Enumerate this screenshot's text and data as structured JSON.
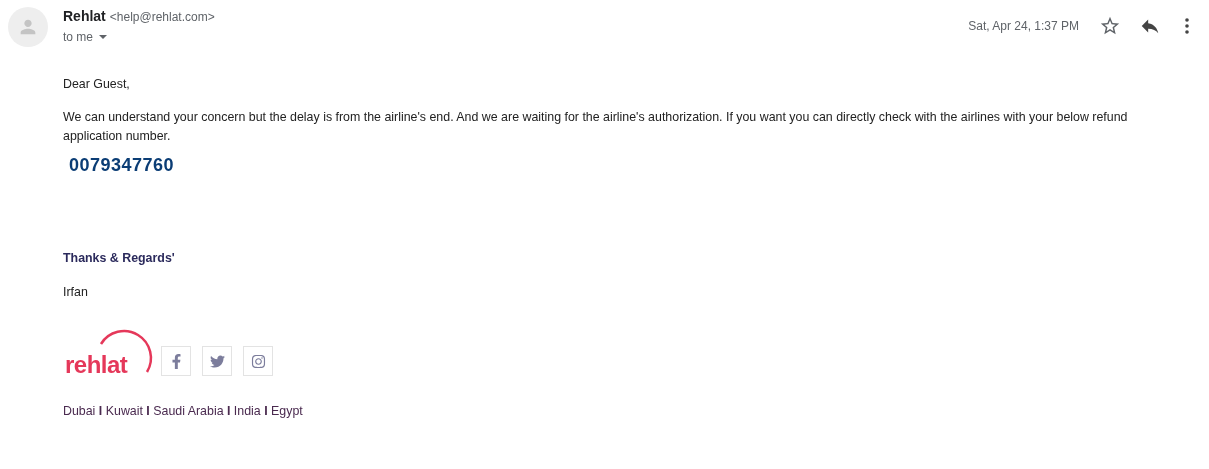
{
  "header": {
    "sender_name": "Rehlat",
    "sender_email": "<help@rehlat.com>",
    "recipient": "to me",
    "date": "Sat, Apr 24, 1:37 PM",
    "starred": false
  },
  "body": {
    "greeting": "Dear Guest,",
    "message": "We can understand your concern but the delay is from the airline's end. And we are waiting for the airline's authorization. If you want you can directly check with the airlines with your below refund application number.",
    "refund_number": "0079347760",
    "closing": "Thanks & Regards'",
    "signer": "Irfan"
  },
  "signature": {
    "logo": "rehlat",
    "social": [
      {
        "kind": "facebook"
      },
      {
        "kind": "twitter"
      },
      {
        "kind": "instagram"
      }
    ],
    "locations": "Dubai **I** Kuwait **I** Saudi Arabia **I** India **I** Egypt"
  }
}
